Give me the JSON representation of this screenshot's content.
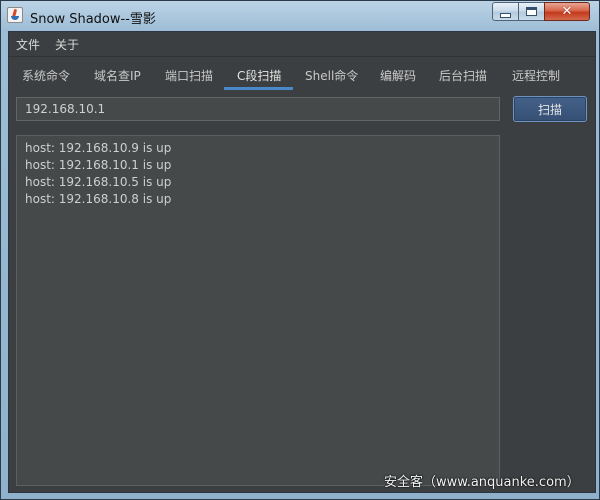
{
  "window": {
    "title": "Snow Shadow--雪影",
    "close_glyph": "✕"
  },
  "menubar": {
    "items": [
      "文件",
      "关于"
    ]
  },
  "tabs": [
    "系统命令",
    "域名查IP",
    "端口扫描",
    "C段扫描",
    "Shell命令",
    "编解码",
    "后台扫描",
    "远程控制"
  ],
  "active_tab": "C段扫描",
  "scan": {
    "ip_value": "192.168.10.1",
    "button_label": "扫描"
  },
  "output": {
    "lines": [
      "host: 192.168.10.9 is up",
      "host: 192.168.10.1 is up",
      "host: 192.168.10.5 is up",
      "host: 192.168.10.8 is up"
    ]
  },
  "watermark": "安全客（www.anquanke.com）",
  "colors": {
    "panel_bg": "#3c3f41",
    "field_bg": "#45494a",
    "accent": "#4a88c7",
    "text": "#cfcfcf"
  }
}
